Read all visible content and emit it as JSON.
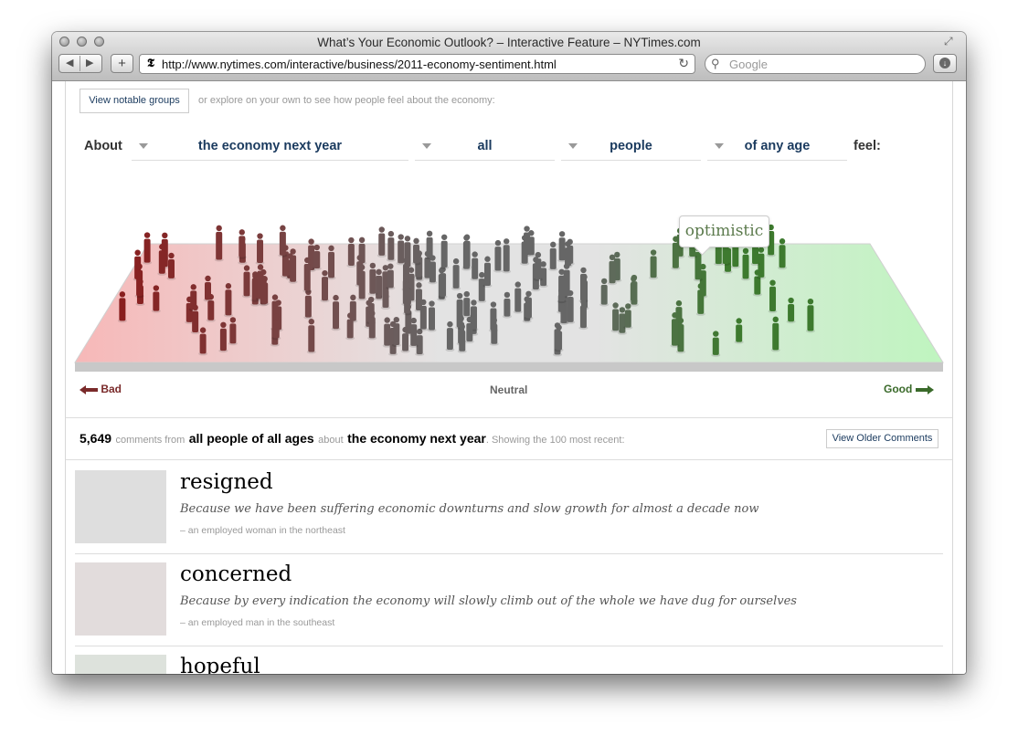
{
  "window": {
    "title": "What’s Your Economic Outlook? – Interactive Feature – NYTimes.com",
    "url": "http://www.nytimes.com/interactive/business/2011-economy-sentiment.html",
    "search_placeholder": "Google",
    "site_glyph": "𝕿",
    "icons": [
      "back-arrow-icon",
      "forward-arrow-icon",
      "plus-icon",
      "reload-icon",
      "search-icon",
      "download-icon",
      "resize-icon"
    ]
  },
  "controls": {
    "notable_button": "View notable groups",
    "explore_text": "or explore on your own to see how people feel about the economy:",
    "about_label": "About",
    "selects": [
      {
        "name": "topic-select",
        "value": "the economy next year"
      },
      {
        "name": "scope-select",
        "value": "all"
      },
      {
        "name": "group-select",
        "value": "people"
      },
      {
        "name": "age-select",
        "value": "of any age"
      }
    ],
    "feel_label": "feel:"
  },
  "chart": {
    "tooltip": "optimistic",
    "axis": {
      "bad": "Bad",
      "neutral": "Neutral",
      "good": "Good"
    },
    "colors": {
      "bad": "#8b1a1a",
      "neutral": "#666666",
      "good": "#3d7a2e"
    }
  },
  "summary": {
    "count": "5,649",
    "t1": "comments from",
    "group": "all people of all ages",
    "t2": "about",
    "topic": "the economy next year",
    "t3": ". Showing the 100 most recent:",
    "older_button": "View Older Comments"
  },
  "comments": [
    {
      "word": "resigned",
      "quote": "Because we have been suffering economic downturns and slow growth for almost a decade now",
      "who": "– an employed woman in the northeast",
      "thumb_color": "#dedede"
    },
    {
      "word": "concerned",
      "quote": "Because by every indication the economy will slowly climb out of the whole we have dug for ourselves",
      "who": "– an employed man in the southeast",
      "thumb_color": "#e2dcdc"
    },
    {
      "word": "hopeful",
      "quote": "",
      "who": "",
      "thumb_color": "#dde2dc"
    }
  ]
}
